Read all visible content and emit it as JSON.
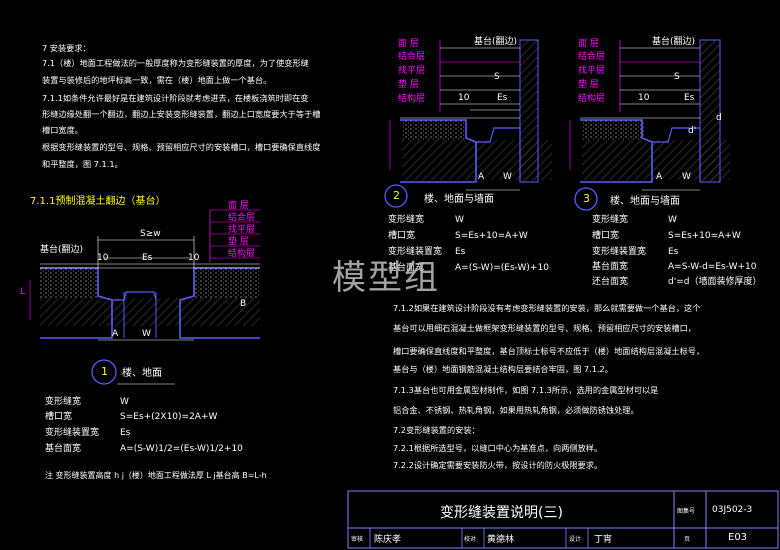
{
  "colors": {
    "background": "#000000",
    "text": "#ffffff",
    "accent": "#ffff00",
    "layers": "#ff00ff",
    "hatch": "#4848ff",
    "border": "#8080ff"
  },
  "notes": {
    "n1": "7 安装要求：",
    "n2": "7.1（楼）地面工程做法的一般厚度称为变形缝装置的厚度，为了使变形缝",
    "n3": "装置与装修后的地坪标高一致，需在（楼）地面上做一个基台。",
    "n4": "7.1.1如条件允许最好是在建筑设计阶段就考虑进去，在楼板浇筑时即在变",
    "n5": "形缝边缘处翻一个翻边，翻边上安装变形缝装置，翻边上口宽度要大于等于槽",
    "n6": "槽口宽度。",
    "n7": "根据变形缝装置的型号、规格、预留相应尺寸的安装槽口，槽口要确保直线度",
    "n8": "和平整度，图     7.1.1。"
  },
  "section_711": "7.1.1预制混凝土翻边（基台）",
  "layers": [
    "面 层",
    "结合层",
    "找平层",
    "垫 层",
    "结构层"
  ],
  "fig1": {
    "sw": "S≥w",
    "base_label": "基台(翻边)",
    "dim_10a": "10",
    "dim_10b": "10",
    "es": "Es",
    "dim_a": "A",
    "dim_w": "W",
    "dim_l": "L",
    "dim_b": "B",
    "num": "1",
    "caption": "楼、地面",
    "specs": [
      {
        "k": "变形缝宽",
        "v": "W"
      },
      {
        "k": "槽口宽",
        "v": "S=Es+(2X10)=2A+W"
      },
      {
        "k": "变形缝装置宽",
        "v": "Es"
      },
      {
        "k": "基台面宽",
        "v": "A=(S-W)1/2=(Es-W)1/2+10"
      }
    ],
    "footnote": "注 变形缝装置高度     h j（楼）地面工程做法厚     L j基台高  B=L-h"
  },
  "fig2": {
    "top_layers": [
      "面 层",
      "结合层",
      "找平层",
      "垫 层",
      "结构层"
    ],
    "base_label": "基台(翻边)",
    "s": "S",
    "dim_10": "10",
    "es": "Es",
    "dim_a": "A",
    "dim_w": "W",
    "num": "2",
    "caption": "楼、地面与墙面",
    "specs": [
      {
        "k": "变形缝宽",
        "v": "W"
      },
      {
        "k": "槽口宽",
        "v": "S=Es+10=A+W"
      },
      {
        "k": "变形缝装置宽",
        "v": "Es"
      },
      {
        "k": "基台面宽",
        "v": "A=(S-W)=(Es-W)+10"
      }
    ]
  },
  "fig3": {
    "top_layers": [
      "面 层",
      "结合层",
      "找平层",
      "垫 层",
      "结构层"
    ],
    "base_label": "基台(翻边)",
    "s": "S",
    "dim_10": "10",
    "es": "Es",
    "dim_d": "d",
    "dim_d2": "d'",
    "dim_a": "A",
    "dim_w": "W",
    "num": "3",
    "caption": "楼、地面与墙面",
    "specs": [
      {
        "k": "变形缝宽",
        "v": "W"
      },
      {
        "k": "槽口宽",
        "v": "S=Es+10=A+W"
      },
      {
        "k": "变形缝装置宽",
        "v": "Es"
      },
      {
        "k": "基台面宽",
        "v": "A=S-W-d=Es-W+10"
      },
      {
        "k": "还台面宽",
        "v": "d'=d（墙面装修厚度）"
      }
    ]
  },
  "notes2": {
    "a": "7.1.2如果在建筑设计阶段没有考虑变形缝装置的安装，那么就需要做一个基台，这个",
    "b": "基台可以用细石混凝土做框架变形缝装置的型号、规格、预留相应尺寸的安装槽口，",
    "c": "槽口要确保直线度和平整度，基台顶标士标号不应低于（楼）地面结构层混凝土标号，",
    "d": "基台与（楼）地面钢筋混凝土结构层要结合牢固，图     7.1.2。",
    "e": "7.1.3基台也可用金属型材制作，如图        7.1.3所示，选用的金属型材可以是",
    "f": "铝合金、不锈钢、热轧角钢，如果用热轧角钢，必须做防锈蚀处理。",
    "g": "7.2变形缝装置的安装：",
    "h": "7.2.1根据所选型号，以缝口中心为基准点，向两侧放样。",
    "i": "7.2.2设计确定需要安装防火带，按设计的防火极限要求。"
  },
  "watermark": "模型组",
  "title_block": {
    "title": "变形缝装置说明(三)",
    "atlas_label": "图集号",
    "atlas_no": "03J502-3",
    "review_label": "审核",
    "review_name": "陈庆孝",
    "check_label": "校对",
    "check_name": "黄德林",
    "design_label": "设计",
    "design_name": "丁宵",
    "page_label": "页",
    "page_no": "E03"
  }
}
